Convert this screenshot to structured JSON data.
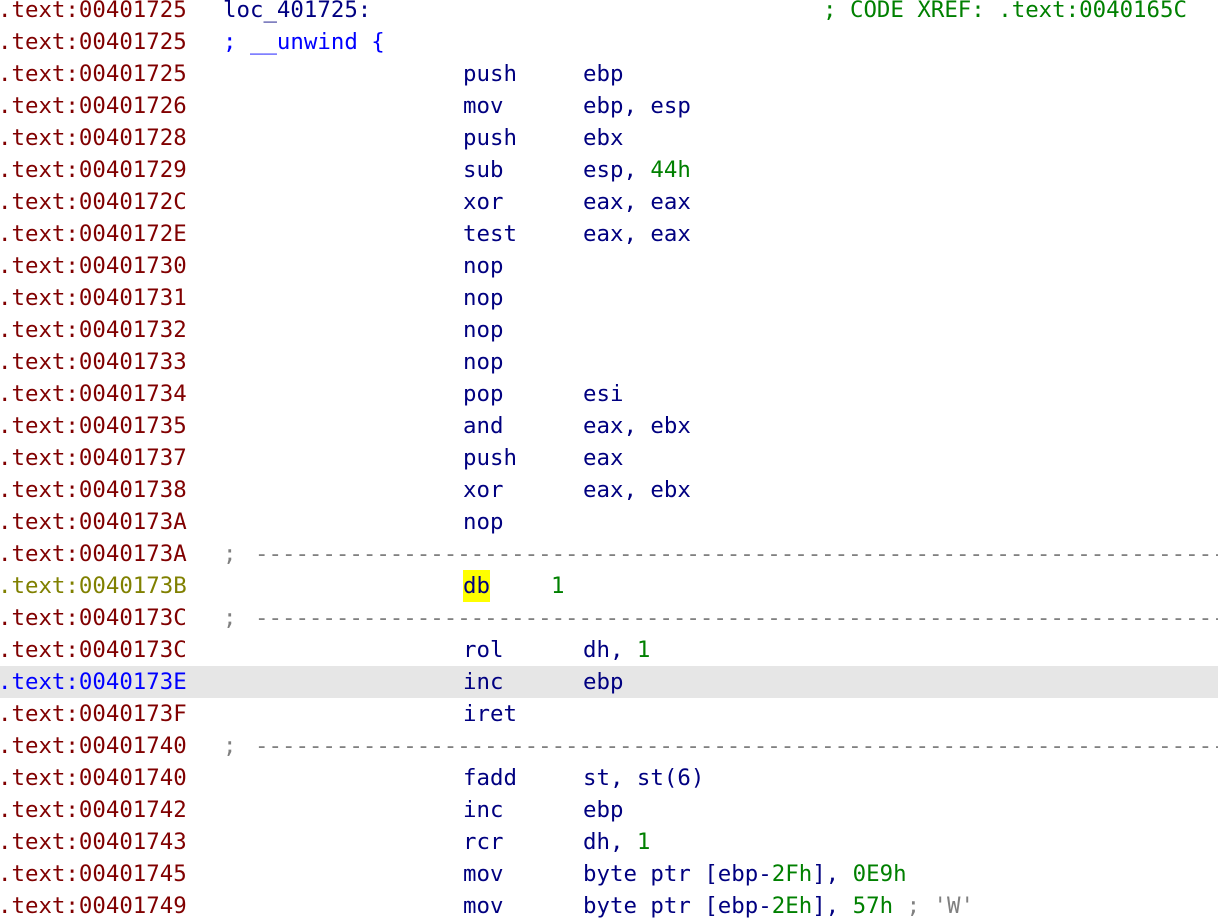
{
  "colors": {
    "address": "#800000",
    "address_data": "#808000",
    "address_current": "#0000ff",
    "mnemonic": "#000080",
    "number": "#008000",
    "comment": "#808080",
    "xref": "#008000",
    "selection_bg": "#e6e6e6",
    "highlight_bg": "#ffff00"
  },
  "lines": [
    {
      "kind": "label",
      "addr": ".text:00401725",
      "label": "loc_401725:",
      "xref": "; CODE XREF: .text:0040165C"
    },
    {
      "kind": "comment",
      "addr": ".text:00401725",
      "text": "; __unwind {"
    },
    {
      "kind": "instr",
      "addr": ".text:00401725",
      "mnem": "push",
      "parts": [
        {
          "t": "ebp"
        }
      ]
    },
    {
      "kind": "instr",
      "addr": ".text:00401726",
      "mnem": "mov",
      "parts": [
        {
          "t": "ebp, esp"
        }
      ]
    },
    {
      "kind": "instr",
      "addr": ".text:00401728",
      "mnem": "push",
      "parts": [
        {
          "t": "ebx"
        }
      ]
    },
    {
      "kind": "instr",
      "addr": ".text:00401729",
      "mnem": "sub",
      "parts": [
        {
          "t": "esp, "
        },
        {
          "t": "44h",
          "c": "num"
        }
      ]
    },
    {
      "kind": "instr",
      "addr": ".text:0040172C",
      "mnem": "xor",
      "parts": [
        {
          "t": "eax, eax"
        }
      ]
    },
    {
      "kind": "instr",
      "addr": ".text:0040172E",
      "mnem": "test",
      "parts": [
        {
          "t": "eax, eax"
        }
      ]
    },
    {
      "kind": "instr",
      "addr": ".text:00401730",
      "mnem": "nop",
      "parts": []
    },
    {
      "kind": "instr",
      "addr": ".text:00401731",
      "mnem": "nop",
      "parts": []
    },
    {
      "kind": "instr",
      "addr": ".text:00401732",
      "mnem": "nop",
      "parts": []
    },
    {
      "kind": "instr",
      "addr": ".text:00401733",
      "mnem": "nop",
      "parts": []
    },
    {
      "kind": "instr",
      "addr": ".text:00401734",
      "mnem": "pop",
      "parts": [
        {
          "t": "esi"
        }
      ]
    },
    {
      "kind": "instr",
      "addr": ".text:00401735",
      "mnem": "and",
      "parts": [
        {
          "t": "eax, ebx"
        }
      ]
    },
    {
      "kind": "instr",
      "addr": ".text:00401737",
      "mnem": "push",
      "parts": [
        {
          "t": "eax"
        }
      ]
    },
    {
      "kind": "instr",
      "addr": ".text:00401738",
      "mnem": "xor",
      "parts": [
        {
          "t": "eax, ebx"
        }
      ]
    },
    {
      "kind": "instr",
      "addr": ".text:0040173A",
      "mnem": "nop",
      "parts": []
    },
    {
      "kind": "sep",
      "addr": ".text:0040173A",
      "semi": ";"
    },
    {
      "kind": "data",
      "addr": ".text:0040173B",
      "mnem": "db",
      "parts": [
        {
          "t": "1",
          "c": "num"
        }
      ]
    },
    {
      "kind": "sep",
      "addr": ".text:0040173C",
      "semi": ";"
    },
    {
      "kind": "instr",
      "addr": ".text:0040173C",
      "mnem": "rol",
      "parts": [
        {
          "t": "dh, "
        },
        {
          "t": "1",
          "c": "num"
        }
      ]
    },
    {
      "kind": "instr",
      "addr": ".text:0040173E",
      "mnem": "inc",
      "parts": [
        {
          "t": "ebp"
        }
      ],
      "selected": true
    },
    {
      "kind": "instr",
      "addr": ".text:0040173F",
      "mnem": "iret",
      "parts": []
    },
    {
      "kind": "sep",
      "addr": ".text:00401740",
      "semi": ";"
    },
    {
      "kind": "instr",
      "addr": ".text:00401740",
      "mnem": "fadd",
      "parts": [
        {
          "t": "st, st(6)"
        }
      ]
    },
    {
      "kind": "instr",
      "addr": ".text:00401742",
      "mnem": "inc",
      "parts": [
        {
          "t": "ebp"
        }
      ]
    },
    {
      "kind": "instr",
      "addr": ".text:00401743",
      "mnem": "rcr",
      "parts": [
        {
          "t": "dh, "
        },
        {
          "t": "1",
          "c": "num"
        }
      ]
    },
    {
      "kind": "instr",
      "addr": ".text:00401745",
      "mnem": "mov",
      "parts": [
        {
          "t": "byte ptr [ebp-"
        },
        {
          "t": "2Fh",
          "c": "num"
        },
        {
          "t": "], "
        },
        {
          "t": "0E9h",
          "c": "num"
        }
      ]
    },
    {
      "kind": "instr",
      "addr": ".text:00401749",
      "mnem": "mov",
      "parts": [
        {
          "t": "byte ptr [ebp-"
        },
        {
          "t": "2Eh",
          "c": "num"
        },
        {
          "t": "], "
        },
        {
          "t": "57h",
          "c": "num"
        },
        {
          "t": " ; 'W'",
          "c": "strc"
        }
      ]
    }
  ]
}
